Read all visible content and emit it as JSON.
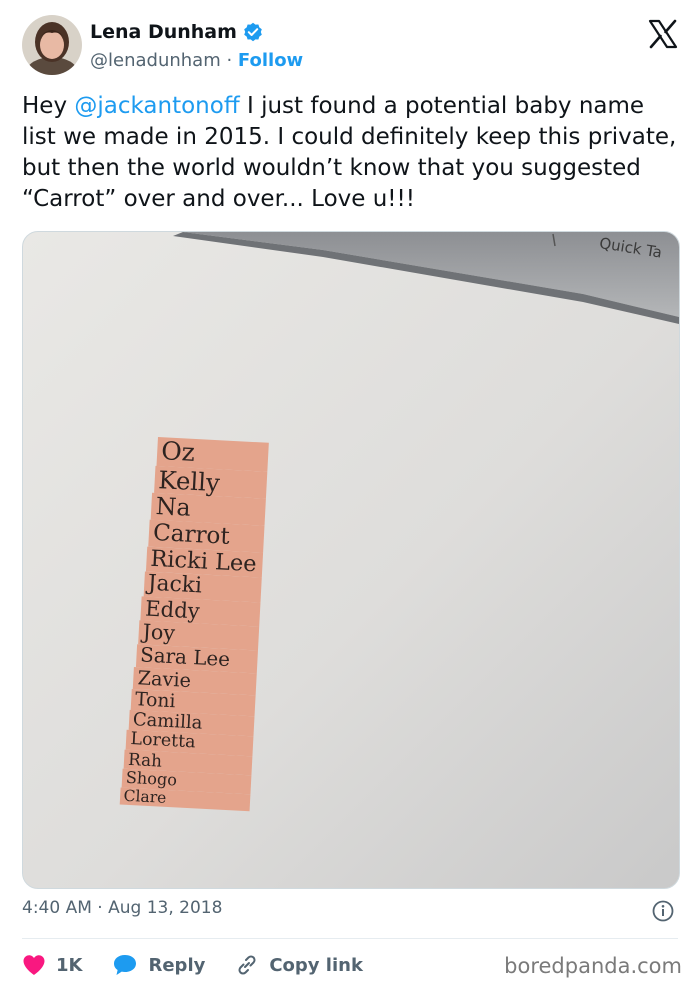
{
  "author": {
    "name": "Lena Dunham",
    "handle": "@lenadunham",
    "separator": "·",
    "follow_label": "Follow"
  },
  "tweet": {
    "text_before": "Hey ",
    "mention": "@jackantonoff",
    "text_after": " I just found a potential baby name list we made in 2015. I could definitely keep this private, but then the world wouldn’t know that you suggested “Carrot” over and over... Love u!!!"
  },
  "photo": {
    "monitor_label": "Quick Ta",
    "names": [
      "Oz",
      "Kelly",
      "Na",
      "Carrot",
      "Ricki Lee",
      "Jacki",
      "Eddy",
      "Joy",
      "Sara Lee",
      "Zavie",
      "Toni",
      "Camilla",
      "Loretta",
      "Rah",
      "Shogo",
      "Clare"
    ]
  },
  "meta": {
    "time": "4:40 AM",
    "separator": "·",
    "date": "Aug 13, 2018"
  },
  "actions": {
    "like_count": "1K",
    "reply_label": "Reply",
    "copy_link_label": "Copy link"
  },
  "watermark": "boredpanda.com",
  "colors": {
    "accent": "#1d9bf0",
    "like": "#f91880",
    "highlight": "#e4a48c"
  }
}
